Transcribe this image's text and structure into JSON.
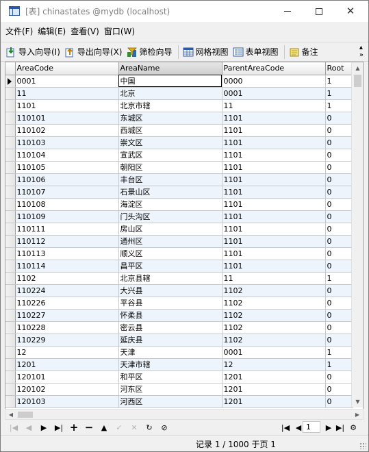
{
  "window": {
    "title": "[表] chinastates @mydb (localhost)",
    "title_color": "#808080"
  },
  "menu": {
    "items": [
      "文件(F)",
      "编辑(E)",
      "查看(V)",
      "窗口(W)"
    ]
  },
  "toolbar": {
    "import_label": "导入向导(I)",
    "export_label": "导出向导(X)",
    "filter_label": "筛检向导",
    "grid_view_label": "网格视图",
    "form_view_label": "表单视图",
    "memo_label": "备注",
    "more_label": "»"
  },
  "grid": {
    "columns": [
      "AreaCode",
      "AreaName",
      "ParentAreaCode",
      "Root"
    ],
    "rows": [
      [
        "0001",
        "中国",
        "0000",
        "1"
      ],
      [
        "11",
        "北京",
        "0001",
        "1"
      ],
      [
        "1101",
        "北京市辖",
        "11",
        "1"
      ],
      [
        "110101",
        "东城区",
        "1101",
        "0"
      ],
      [
        "110102",
        "西城区",
        "1101",
        "0"
      ],
      [
        "110103",
        "崇文区",
        "1101",
        "0"
      ],
      [
        "110104",
        "宣武区",
        "1101",
        "0"
      ],
      [
        "110105",
        "朝阳区",
        "1101",
        "0"
      ],
      [
        "110106",
        "丰台区",
        "1101",
        "0"
      ],
      [
        "110107",
        "石景山区",
        "1101",
        "0"
      ],
      [
        "110108",
        "海淀区",
        "1101",
        "0"
      ],
      [
        "110109",
        "门头沟区",
        "1101",
        "0"
      ],
      [
        "110111",
        "房山区",
        "1101",
        "0"
      ],
      [
        "110112",
        "通州区",
        "1101",
        "0"
      ],
      [
        "110113",
        "顺义区",
        "1101",
        "0"
      ],
      [
        "110114",
        "昌平区",
        "1101",
        "0"
      ],
      [
        "1102",
        "北京县辖",
        "11",
        "1"
      ],
      [
        "110224",
        "大兴县",
        "1102",
        "0"
      ],
      [
        "110226",
        "平谷县",
        "1102",
        "0"
      ],
      [
        "110227",
        "怀柔县",
        "1102",
        "0"
      ],
      [
        "110228",
        "密云县",
        "1102",
        "0"
      ],
      [
        "110229",
        "延庆县",
        "1102",
        "0"
      ],
      [
        "12",
        "天津",
        "0001",
        "1"
      ],
      [
        "1201",
        "天津市辖",
        "12",
        "1"
      ],
      [
        "120101",
        "和平区",
        "1201",
        "0"
      ],
      [
        "120102",
        "河东区",
        "1201",
        "0"
      ],
      [
        "120103",
        "河西区",
        "1201",
        "0"
      ]
    ],
    "alt_row_color": "#eef4fb"
  },
  "navbar": {
    "page_value": "1"
  },
  "status": {
    "text": "记录 1 / 1000 于页 1"
  },
  "colors": {
    "window_bg": "#f0f0f0",
    "grid_border": "#a0a0a0"
  }
}
